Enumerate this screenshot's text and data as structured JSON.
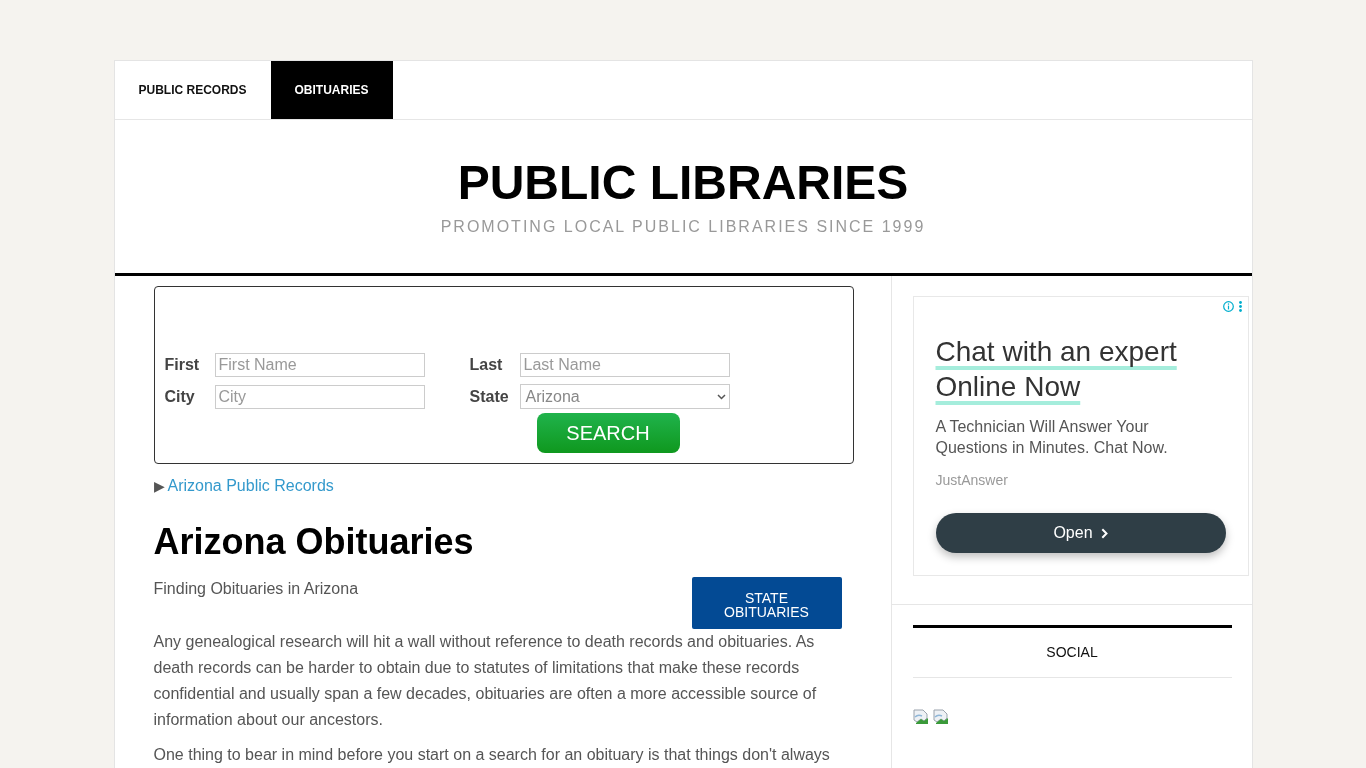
{
  "nav": {
    "tabs": [
      {
        "label": "PUBLIC RECORDS",
        "selected": false
      },
      {
        "label": "OBITUARIES",
        "selected": true
      }
    ]
  },
  "header": {
    "title": "PUBLIC LIBRARIES",
    "tagline": "PROMOTING LOCAL PUBLIC LIBRARIES SINCE 1999"
  },
  "search_form": {
    "fields": [
      {
        "kind": "text",
        "label": "First",
        "placeholder": "First Name"
      },
      {
        "kind": "text",
        "label": "Last",
        "placeholder": "Last Name"
      },
      {
        "kind": "text",
        "label": "City",
        "placeholder": "City"
      },
      {
        "kind": "select",
        "label": "State",
        "value": "Arizona"
      }
    ],
    "button": "SEARCH"
  },
  "breadcrumb": {
    "marker": "▶",
    "link": "Arizona Public Records"
  },
  "article": {
    "title": "Arizona Obituaries",
    "subtitle": "Finding Obituaries in Arizona",
    "button": "STATE OBITUARIES",
    "paragraphs": [
      "Any genealogical research will hit a wall without reference to death records and obituaries. As death records can be harder to obtain due to statutes of limitations that make these records confidential and usually span a few decades, obituaries are often a more accessible source of information about our ancestors.",
      "One thing to bear in mind before you start on a search for an obituary is that things don't always"
    ]
  },
  "ad": {
    "headline": "Chat with an expert Online Now",
    "description": "A Technician Will Answer Your Questions in Minutes. Chat Now.",
    "advertiser": "JustAnswer",
    "button": "Open"
  },
  "social": {
    "title": "SOCIAL"
  }
}
